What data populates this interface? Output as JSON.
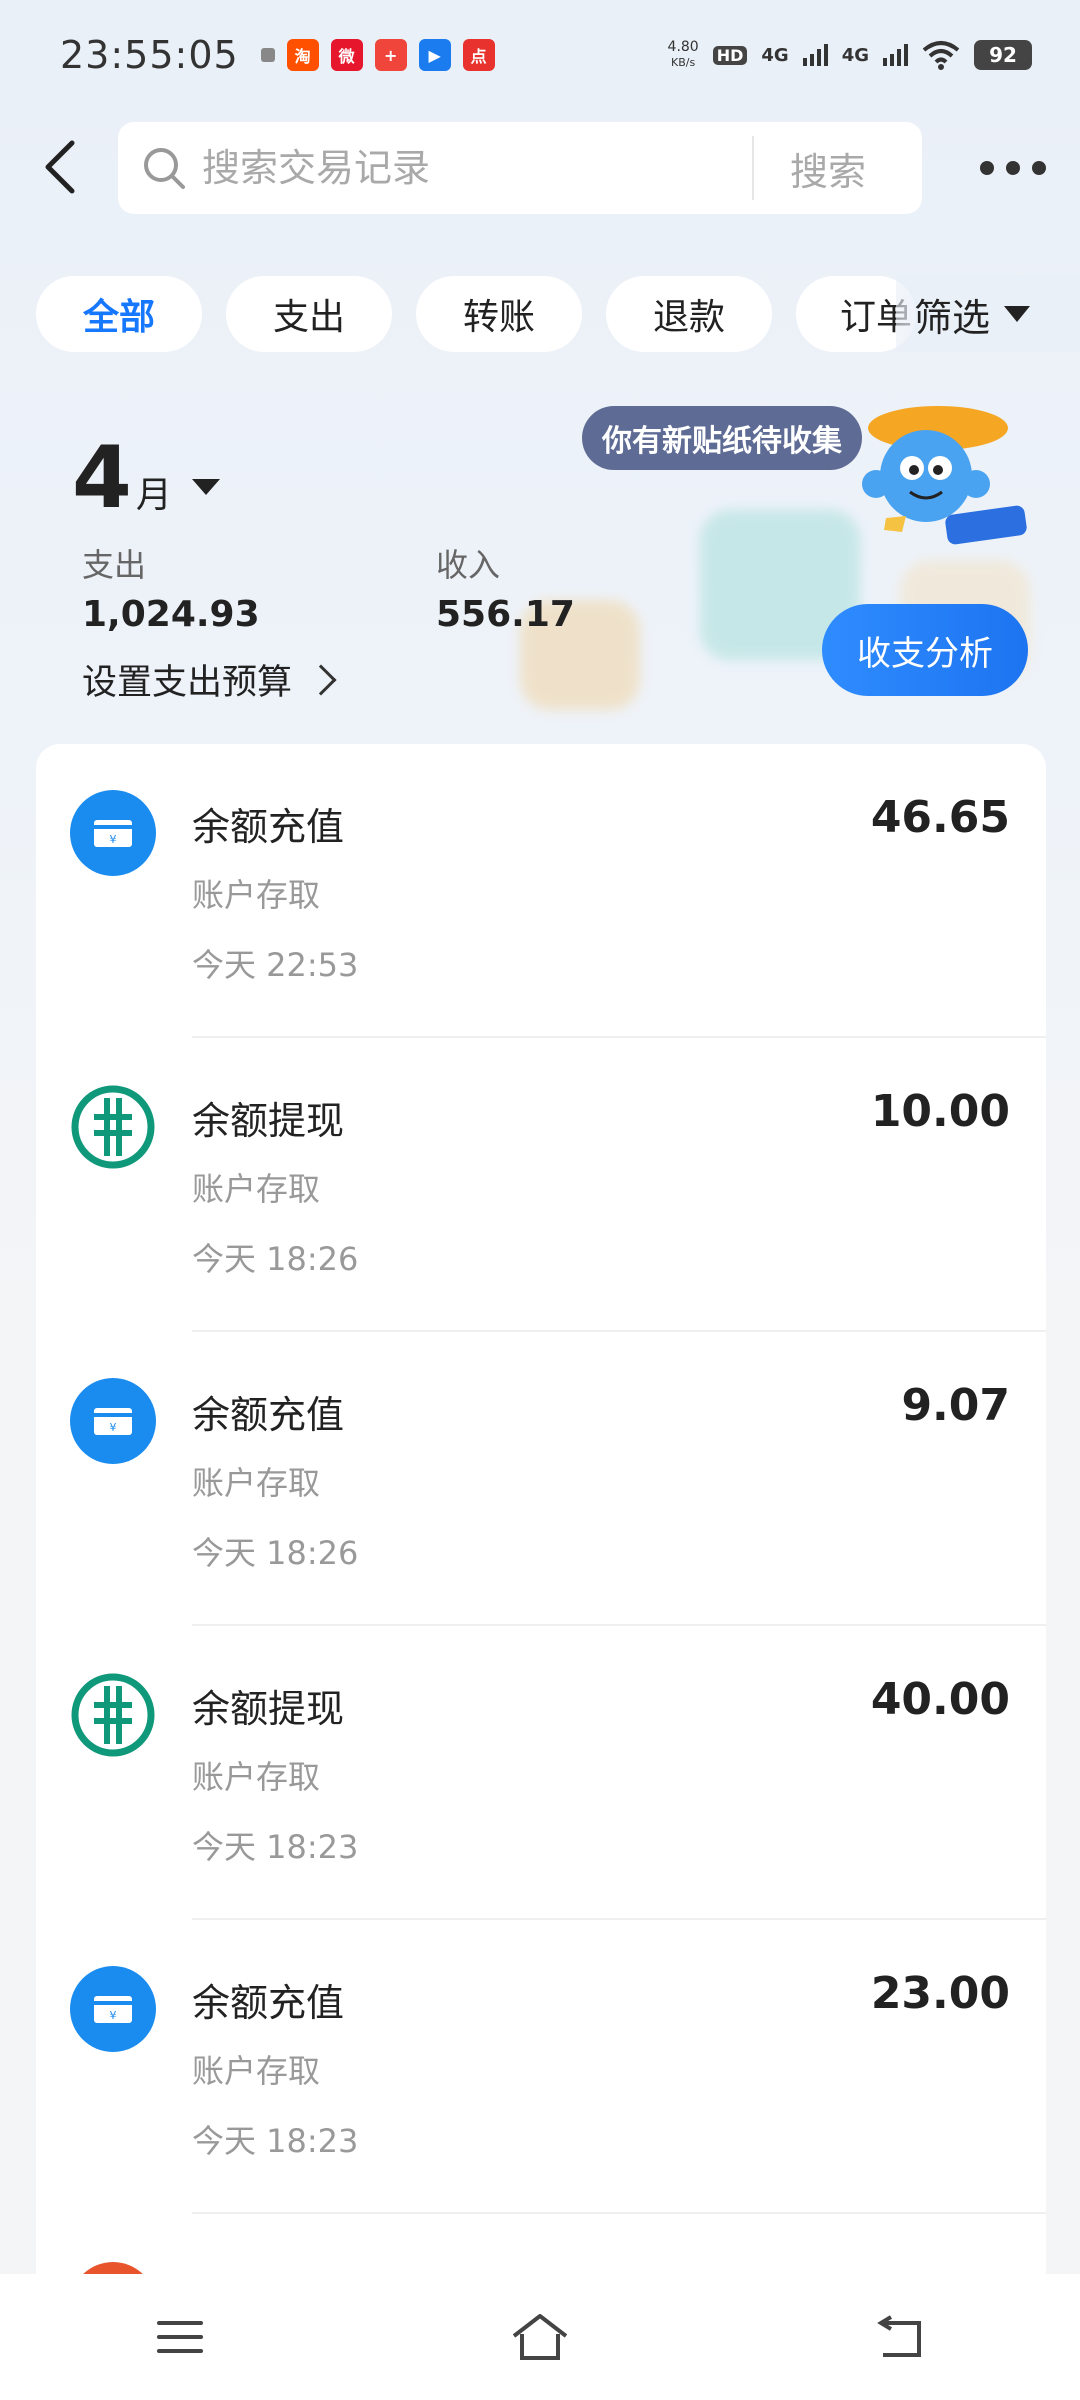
{
  "status_bar": {
    "time": "23:55:05",
    "net_speed_value": "4.80",
    "net_speed_unit": "KB/s",
    "hd_label": "HD",
    "signal1": "4G",
    "signal2": "4G",
    "battery": "92"
  },
  "search": {
    "placeholder": "搜索交易记录",
    "button_label": "搜索"
  },
  "filters": {
    "chips": [
      "全部",
      "支出",
      "转账",
      "退款",
      "订单"
    ],
    "active_index": 0,
    "filter_label": "筛选"
  },
  "summary": {
    "month_number": "4",
    "month_unit": "月",
    "expense_label": "支出",
    "expense_value": "1,024.93",
    "income_label": "收入",
    "income_value": "556.17",
    "budget_link": "设置支出预算",
    "analysis_button": "收支分析",
    "sticker_bubble": "你有新贴纸待收集"
  },
  "transactions": [
    {
      "title": "余额充值",
      "category": "账户存取",
      "time": "今天 22:53",
      "amount": "46.65",
      "icon": "card-icon"
    },
    {
      "title": "余额提现",
      "category": "账户存取",
      "time": "今天 18:26",
      "amount": "10.00",
      "icon": "bank-logo-icon"
    },
    {
      "title": "余额充值",
      "category": "账户存取",
      "time": "今天 18:26",
      "amount": "9.07",
      "icon": "card-icon"
    },
    {
      "title": "余额提现",
      "category": "账户存取",
      "time": "今天 18:23",
      "amount": "40.00",
      "icon": "bank-logo-icon"
    },
    {
      "title": "余额充值",
      "category": "账户存取",
      "time": "今天 18:23",
      "amount": "23.00",
      "icon": "card-icon"
    }
  ],
  "colors": {
    "accent": "#1677ff",
    "card_icon_bg": "#1a8cf0",
    "bank_green": "#10987a"
  }
}
